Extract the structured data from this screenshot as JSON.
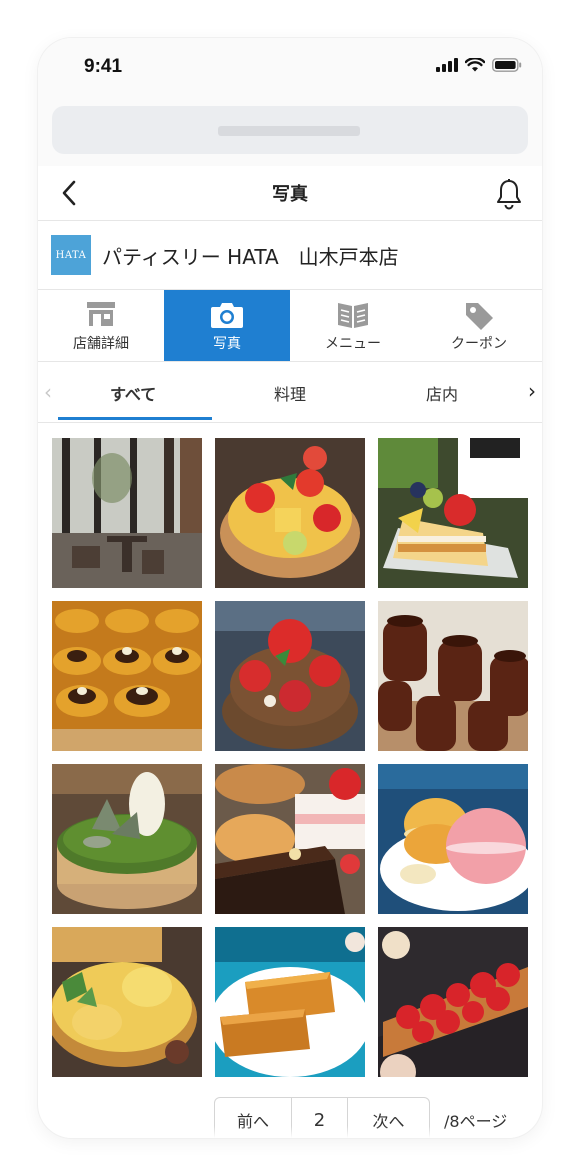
{
  "status_bar": {
    "time": "9:41"
  },
  "nav": {
    "title": "写真"
  },
  "shop": {
    "logo_text": "HATA",
    "name": "パティスリー HATA　山木戸本店"
  },
  "tabs": [
    {
      "label": "店舗詳細",
      "icon": "store-icon",
      "active": false
    },
    {
      "label": "写真",
      "icon": "camera-icon",
      "active": true
    },
    {
      "label": "メニュー",
      "icon": "menu-book-icon",
      "active": false
    },
    {
      "label": "クーポン",
      "icon": "coupon-tag-icon",
      "active": false
    }
  ],
  "subtabs": [
    {
      "label": "すべて",
      "active": true
    },
    {
      "label": "料理",
      "active": false
    },
    {
      "label": "店内",
      "active": false
    }
  ],
  "photos": [
    "cafe-interior",
    "fruit-tart",
    "strawberry-shortcake-slice",
    "glazed-pastries",
    "strawberry-chocolate-tart",
    "canneles",
    "matcha-cake",
    "assorted-cake-slices",
    "macarons",
    "cheese-tart",
    "financiers",
    "strawberry-tart"
  ],
  "pagination": {
    "prev_label": "前へ",
    "current_page": "2",
    "next_label": "次へ",
    "total_label": "/8ページ"
  },
  "colors": {
    "accent": "#1f7fd1",
    "logo": "#4da3d8"
  }
}
